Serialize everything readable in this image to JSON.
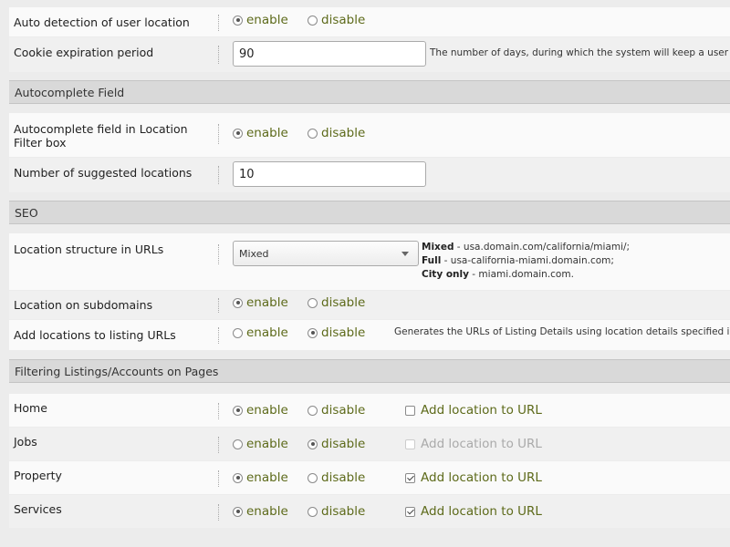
{
  "general": {
    "auto_detection": {
      "label": "Auto detection of user location",
      "enable": "enable",
      "disable": "disable",
      "selected": "enable"
    },
    "cookie": {
      "label": "Cookie expiration period",
      "value": "90",
      "hint": "The number of days, during which the system will keep a user location"
    }
  },
  "autocomplete": {
    "section_title": "Autocomplete Field",
    "field": {
      "label": "Autocomplete field in Location Filter box",
      "enable": "enable",
      "disable": "disable",
      "selected": "enable"
    },
    "suggested": {
      "label": "Number of suggested locations",
      "value": "10"
    }
  },
  "seo": {
    "section_title": "SEO",
    "structure": {
      "label": "Location structure in URLs",
      "selected": "Mixed",
      "desc": [
        {
          "name": "Mixed",
          "example": " - usa.domain.com/california/miami/;"
        },
        {
          "name": "Full",
          "example": " - usa-california-miami.domain.com;"
        },
        {
          "name": "City only",
          "example": " - miami.domain.com."
        }
      ]
    },
    "subdomains": {
      "label": "Location on subdomains",
      "enable": "enable",
      "disable": "disable",
      "selected": "enable"
    },
    "listing_urls": {
      "label": "Add locations to listing URLs",
      "enable": "enable",
      "disable": "disable",
      "selected": "disable",
      "hint": "Generates the URLs of Listing Details using location details specified in listings"
    }
  },
  "filtering": {
    "section_title": "Filtering Listings/Accounts on Pages",
    "enable_label": "enable",
    "disable_label": "disable",
    "add_location_label": "Add location to URL",
    "pages": [
      {
        "name": "Home",
        "selected": "enable",
        "add_location": false,
        "add_location_disabled": false
      },
      {
        "name": "Jobs",
        "selected": "disable",
        "add_location": false,
        "add_location_disabled": true
      },
      {
        "name": "Property",
        "selected": "enable",
        "add_location": true,
        "add_location_disabled": false
      },
      {
        "name": "Services",
        "selected": "enable",
        "add_location": true,
        "add_location_disabled": false
      }
    ]
  }
}
